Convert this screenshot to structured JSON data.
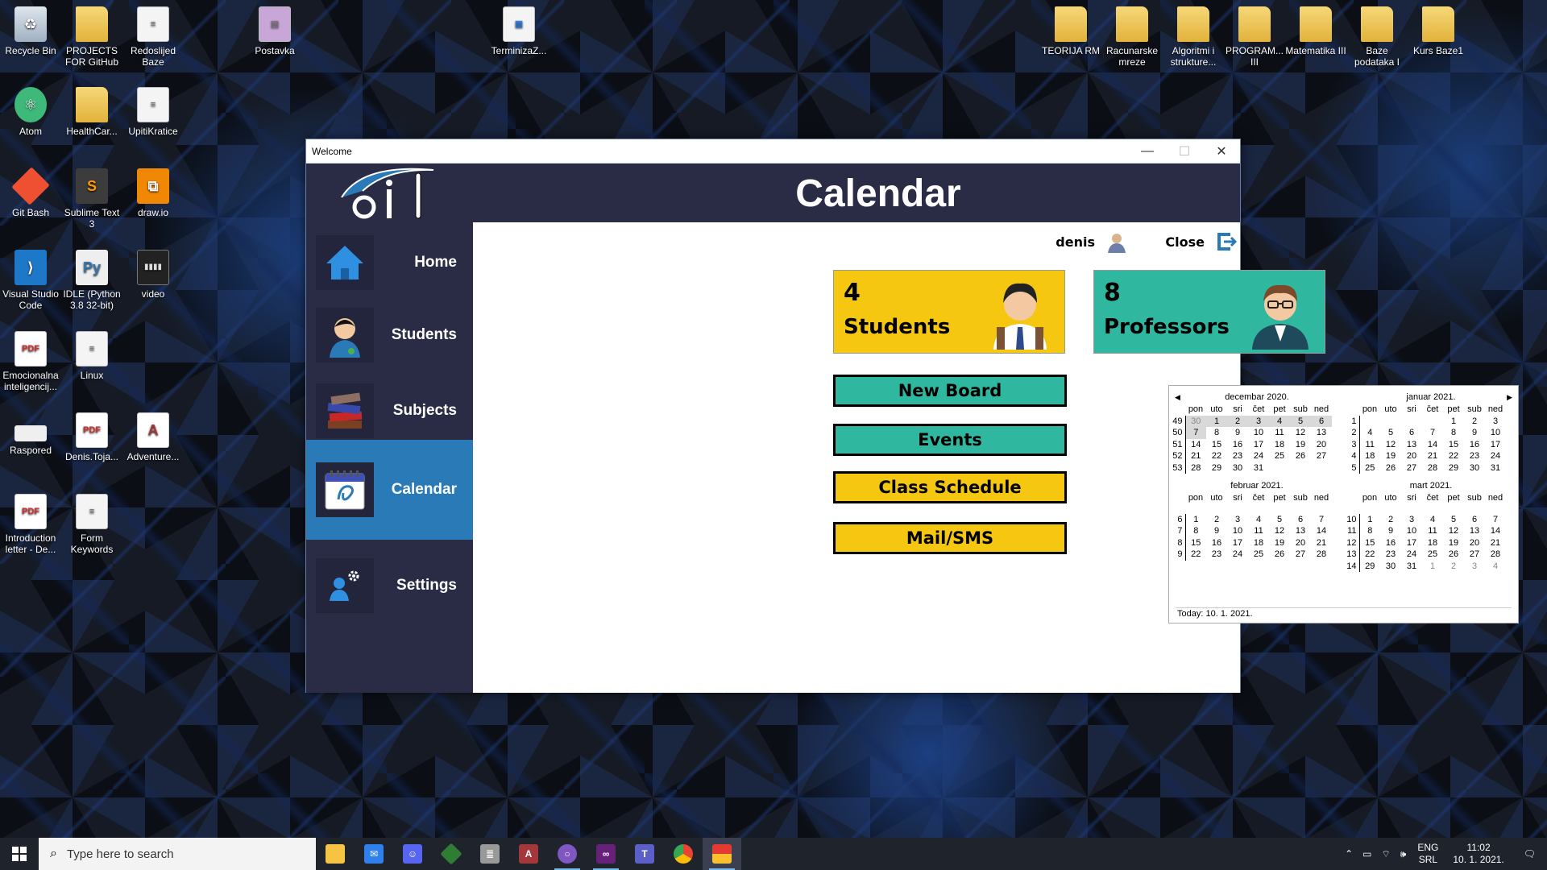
{
  "desktop": {
    "icons": [
      {
        "label": "Recycle Bin",
        "icon": "recycle-bin-icon"
      },
      {
        "label": "PROJECTS FOR GitHub",
        "icon": "folder-icon"
      },
      {
        "label": "Redoslijed Baze",
        "icon": "document-icon"
      },
      {
        "label": "Postavka",
        "icon": "archive-icon"
      },
      {
        "label": "TerminizaZ...",
        "icon": "calendar-file-icon"
      },
      {
        "label": "TEORIJA RM",
        "icon": "folder-icon"
      },
      {
        "label": "Racunarske mreze",
        "icon": "folder-icon"
      },
      {
        "label": "Algoritmi i strukture...",
        "icon": "folder-icon"
      },
      {
        "label": "PROGRAM... III",
        "icon": "folder-icon"
      },
      {
        "label": "Matematika III",
        "icon": "folder-icon"
      },
      {
        "label": "Baze podataka I",
        "icon": "folder-icon"
      },
      {
        "label": "Kurs Baze1",
        "icon": "folder-icon"
      },
      {
        "label": "Atom",
        "icon": "atom-icon"
      },
      {
        "label": "HealthCar...",
        "icon": "folder-icon"
      },
      {
        "label": "UpitiKratice",
        "icon": "document-icon"
      },
      {
        "label": "Git Bash",
        "icon": "git-icon"
      },
      {
        "label": "Sublime Text 3",
        "icon": "sublime-icon"
      },
      {
        "label": "draw.io",
        "icon": "drawio-icon"
      },
      {
        "label": "Visual Studio Code",
        "icon": "vscode-icon"
      },
      {
        "label": "IDLE (Python 3.8 32-bit)",
        "icon": "python-icon"
      },
      {
        "label": "video",
        "icon": "video-icon"
      },
      {
        "label": "Emocionalna inteligencij...",
        "icon": "pdf-icon"
      },
      {
        "label": "Linux",
        "icon": "document-icon"
      },
      {
        "label": "Raspored",
        "icon": "image-icon"
      },
      {
        "label": "Denis.Toja...",
        "icon": "pdf-icon"
      },
      {
        "label": "Adventure...",
        "icon": "access-icon"
      },
      {
        "label": "Introduction letter - De...",
        "icon": "pdf-icon"
      },
      {
        "label": "Form Keywords",
        "icon": "document-icon"
      }
    ]
  },
  "window": {
    "title": "Welcome",
    "minimize": "—",
    "maximize": "☐",
    "close": "✕"
  },
  "header": {
    "title": "Calendar"
  },
  "sidebar": {
    "items": [
      {
        "label": "Home",
        "icon": "home-icon"
      },
      {
        "label": "Students",
        "icon": "student-icon"
      },
      {
        "label": "Subjects",
        "icon": "books-icon"
      },
      {
        "label": "Calendar",
        "icon": "calendar-icon",
        "active": true
      },
      {
        "label": "Settings",
        "icon": "settings-user-icon"
      }
    ]
  },
  "topbar": {
    "user": "denis",
    "close_label": "Close"
  },
  "cards": {
    "students": {
      "count": "4",
      "label": "Students"
    },
    "professors": {
      "count": "8",
      "label": "Professors"
    }
  },
  "actions": {
    "new_board": "New Board",
    "events": "Events",
    "class_schedule": "Class Schedule",
    "mail_sms": "Mail/SMS"
  },
  "calendar": {
    "day_headers": [
      "pon",
      "uto",
      "sri",
      "čet",
      "pet",
      "sub",
      "ned"
    ],
    "today_text": "Today: 10. 1. 2021.",
    "prev_arrow": "◀",
    "next_arrow": "▶",
    "months": [
      {
        "name": "decembar 2020.",
        "weeks": [
          {
            "wk": "49",
            "days": [
              "30",
              "1",
              "2",
              "3",
              "4",
              "5",
              "6"
            ]
          },
          {
            "wk": "50",
            "days": [
              "7",
              "8",
              "9",
              "10",
              "11",
              "12",
              "13"
            ]
          },
          {
            "wk": "51",
            "days": [
              "14",
              "15",
              "16",
              "17",
              "18",
              "19",
              "20"
            ]
          },
          {
            "wk": "52",
            "days": [
              "21",
              "22",
              "23",
              "24",
              "25",
              "26",
              "27"
            ]
          },
          {
            "wk": "53",
            "days": [
              "28",
              "29",
              "30",
              "31",
              "",
              "",
              ""
            ]
          }
        ]
      },
      {
        "name": "januar 2021.",
        "weeks": [
          {
            "wk": "1",
            "days": [
              "",
              "",
              "",
              "",
              "1",
              "2",
              "3"
            ]
          },
          {
            "wk": "2",
            "days": [
              "4",
              "5",
              "6",
              "7",
              "8",
              "9",
              "10"
            ]
          },
          {
            "wk": "3",
            "days": [
              "11",
              "12",
              "13",
              "14",
              "15",
              "16",
              "17"
            ]
          },
          {
            "wk": "4",
            "days": [
              "18",
              "19",
              "20",
              "21",
              "22",
              "23",
              "24"
            ]
          },
          {
            "wk": "5",
            "days": [
              "25",
              "26",
              "27",
              "28",
              "29",
              "30",
              "31"
            ]
          }
        ]
      },
      {
        "name": "februar 2021.",
        "weeks": [
          {
            "wk": "6",
            "days": [
              "1",
              "2",
              "3",
              "4",
              "5",
              "6",
              "7"
            ]
          },
          {
            "wk": "7",
            "days": [
              "8",
              "9",
              "10",
              "11",
              "12",
              "13",
              "14"
            ]
          },
          {
            "wk": "8",
            "days": [
              "15",
              "16",
              "17",
              "18",
              "19",
              "20",
              "21"
            ]
          },
          {
            "wk": "9",
            "days": [
              "22",
              "23",
              "24",
              "25",
              "26",
              "27",
              "28"
            ]
          }
        ]
      },
      {
        "name": "mart 2021.",
        "weeks": [
          {
            "wk": "10",
            "days": [
              "1",
              "2",
              "3",
              "4",
              "5",
              "6",
              "7"
            ]
          },
          {
            "wk": "11",
            "days": [
              "8",
              "9",
              "10",
              "11",
              "12",
              "13",
              "14"
            ]
          },
          {
            "wk": "12",
            "days": [
              "15",
              "16",
              "17",
              "18",
              "19",
              "20",
              "21"
            ]
          },
          {
            "wk": "13",
            "days": [
              "22",
              "23",
              "24",
              "25",
              "26",
              "27",
              "28"
            ]
          },
          {
            "wk": "14",
            "days": [
              "29",
              "30",
              "31",
              "1",
              "2",
              "3",
              "4"
            ]
          }
        ]
      }
    ]
  },
  "taskbar": {
    "search_placeholder": "Type here to search",
    "lang": "ENG",
    "layout": "SRL",
    "time": "11:02",
    "date": "10. 1. 2021."
  }
}
